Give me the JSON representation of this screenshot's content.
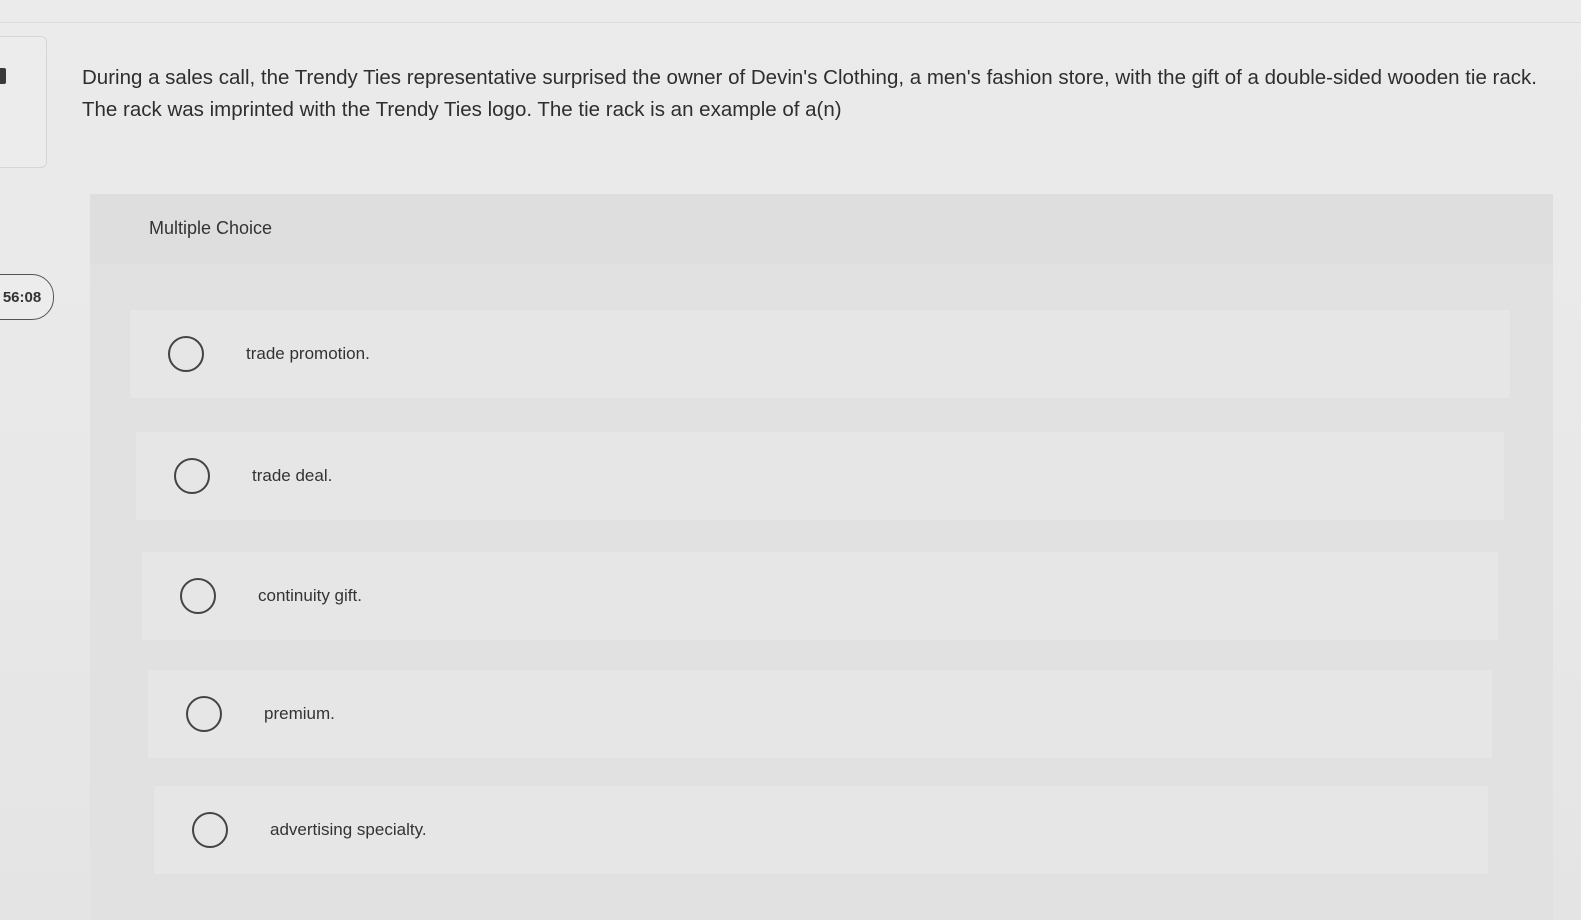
{
  "timer": {
    "text": "56:08"
  },
  "question": {
    "text": "During a sales call, the Trendy Ties representative surprised the owner of Devin's Clothing, a men's fashion store, with the gift of a double-sided wooden tie rack. The rack was imprinted with the Trendy Ties logo. The tie rack is an example of a(n)"
  },
  "multiple_choice": {
    "title": "Multiple Choice",
    "options": [
      {
        "label": "trade promotion."
      },
      {
        "label": "trade deal."
      },
      {
        "label": "continuity gift."
      },
      {
        "label": "premium."
      },
      {
        "label": "advertising specialty."
      }
    ]
  }
}
